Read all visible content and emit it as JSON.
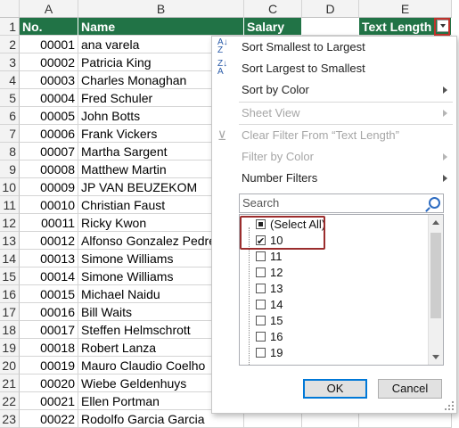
{
  "columns": [
    "A",
    "B",
    "C",
    "D",
    "E"
  ],
  "header": {
    "no": "No.",
    "name": "Name",
    "salary": "Salary",
    "text_length": "Text Length"
  },
  "row_numbers": [
    "1",
    "2",
    "3",
    "4",
    "5",
    "6",
    "7",
    "8",
    "9",
    "10",
    "11",
    "12",
    "13",
    "14",
    "15",
    "16",
    "17",
    "18",
    "19",
    "20",
    "21",
    "22",
    "23"
  ],
  "rows": [
    {
      "no": "00001",
      "name": "ana varela"
    },
    {
      "no": "00002",
      "name": "Patricia King"
    },
    {
      "no": "00003",
      "name": "Charles Monaghan"
    },
    {
      "no": "00004",
      "name": "Fred Schuler"
    },
    {
      "no": "00005",
      "name": "John Botts"
    },
    {
      "no": "00006",
      "name": "Frank Vickers"
    },
    {
      "no": "00007",
      "name": "Martha Sargent"
    },
    {
      "no": "00008",
      "name": "Matthew Martin"
    },
    {
      "no": "00009",
      "name": "JP VAN BEUZEKOM"
    },
    {
      "no": "00010",
      "name": "Christian Faust"
    },
    {
      "no": "00011",
      "name": "Ricky Kwon"
    },
    {
      "no": "00012",
      "name": "Alfonso Gonzalez Pedre"
    },
    {
      "no": "00013",
      "name": "Simone Williams"
    },
    {
      "no": "00014",
      "name": "Simone Williams"
    },
    {
      "no": "00015",
      "name": "Michael Naidu"
    },
    {
      "no": "00016",
      "name": "Bill Waits"
    },
    {
      "no": "00017",
      "name": "Steffen Helmschrott"
    },
    {
      "no": "00018",
      "name": "Robert Lanza"
    },
    {
      "no": "00019",
      "name": "Mauro Claudio Coelho"
    },
    {
      "no": "00020",
      "name": "Wiebe Geldenhuys"
    },
    {
      "no": "00021",
      "name": "Ellen Portman"
    },
    {
      "no": "00022",
      "name": "Rodolfo Garcia Garcia"
    }
  ],
  "menu": {
    "sort_asc": "Sort Smallest to Largest",
    "sort_desc": "Sort Largest to Smallest",
    "sort_color": "Sort by Color",
    "sheet_view": "Sheet View",
    "clear_filter": "Clear Filter From “Text Length”",
    "filter_color": "Filter by Color",
    "number_filters": "Number Filters",
    "search_placeholder": "Search",
    "ok": "OK",
    "cancel": "Cancel",
    "items": [
      {
        "label": "(Select All)",
        "state": "partial"
      },
      {
        "label": "10",
        "state": "checked"
      },
      {
        "label": "11",
        "state": "unchecked"
      },
      {
        "label": "12",
        "state": "unchecked"
      },
      {
        "label": "13",
        "state": "unchecked"
      },
      {
        "label": "14",
        "state": "unchecked"
      },
      {
        "label": "15",
        "state": "unchecked"
      },
      {
        "label": "16",
        "state": "unchecked"
      },
      {
        "label": "19",
        "state": "unchecked"
      }
    ]
  },
  "icons": {
    "sort_asc": "sort-ascending-icon",
    "sort_desc": "sort-descending-icon",
    "clear": "clear-filter-icon",
    "search": "search-icon"
  },
  "colors": {
    "header_fill": "#217346",
    "highlight": "#c0322b"
  }
}
